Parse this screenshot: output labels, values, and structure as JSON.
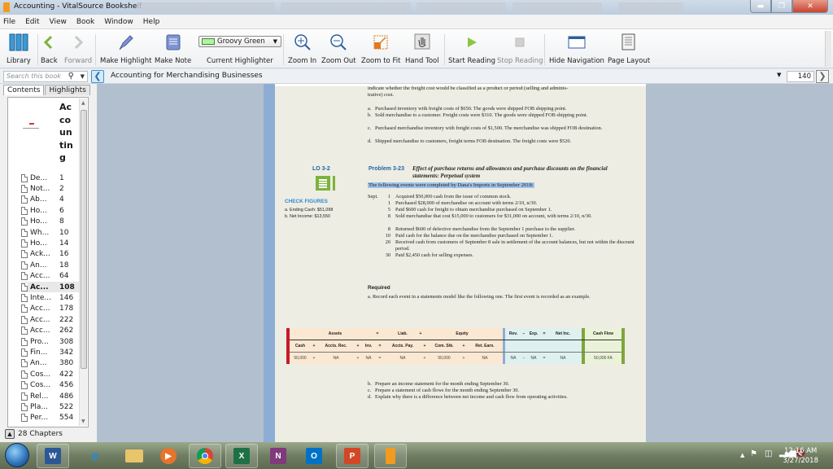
{
  "window": {
    "title": "Accounting - VitalSource Bookshelf",
    "controls": [
      "minimize",
      "restore",
      "close"
    ]
  },
  "menu": [
    "File",
    "Edit",
    "View",
    "Book",
    "Window",
    "Help"
  ],
  "toolbar": {
    "library": "Library",
    "back": "Back",
    "forward": "Forward",
    "make_highlight": "Make Highlight",
    "make_note": "Make Note",
    "highlighter_value": "Groovy Green",
    "highlighter_label": "Current Highlighter",
    "zoom_in": "Zoom In",
    "zoom_out": "Zoom Out",
    "zoom_fit": "Zoom to Fit",
    "hand_tool": "Hand Tool",
    "start_reading": "Start Reading",
    "stop_reading": "Stop Reading",
    "hide_nav": "Hide Navigation",
    "page_layout": "Page Layout",
    "highlight_color": "#b6f0a8"
  },
  "nav": {
    "search_placeholder": "Search this book",
    "breadcrumb": "Accounting for Merchandising Businesses",
    "page": "140"
  },
  "sidebar": {
    "tabs": [
      "Contents",
      "Highlights"
    ],
    "cover_title": "Ac co un tin g",
    "toc": [
      {
        "t": "De...",
        "p": "1"
      },
      {
        "t": "Not...",
        "p": "2"
      },
      {
        "t": "Ab...",
        "p": "4"
      },
      {
        "t": "Ho...",
        "p": "6"
      },
      {
        "t": "Ho...",
        "p": "8"
      },
      {
        "t": "Wh...",
        "p": "10"
      },
      {
        "t": "Ho...",
        "p": "14"
      },
      {
        "t": "Ack...",
        "p": "16"
      },
      {
        "t": "An...",
        "p": "18"
      },
      {
        "t": "Acc...",
        "p": "64"
      },
      {
        "t": "Ac...",
        "p": "108",
        "selected": true
      },
      {
        "t": "Inte...",
        "p": "146"
      },
      {
        "t": "Acc...",
        "p": "178"
      },
      {
        "t": "Acc...",
        "p": "222"
      },
      {
        "t": "Acc...",
        "p": "262"
      },
      {
        "t": "Pro...",
        "p": "308"
      },
      {
        "t": "Fin...",
        "p": "342"
      },
      {
        "t": "An...",
        "p": "380"
      },
      {
        "t": "Cos...",
        "p": "422"
      },
      {
        "t": "Cos...",
        "p": "456"
      },
      {
        "t": "Rel...",
        "p": "486"
      },
      {
        "t": "Pla...",
        "p": "522"
      },
      {
        "t": "Per...",
        "p": "554"
      }
    ],
    "chapters": "28 Chapters"
  },
  "page": {
    "intro1": "indicate whether the freight cost would be classified as a product or period (selling and adminis-",
    "intro2": "trative) cost.",
    "items": [
      {
        "l": "a.",
        "t": "Purchased inventory with freight costs of $650. The goods were shipped FOB shipping point."
      },
      {
        "l": "b.",
        "t": "Sold merchandise to a customer. Freight costs were $310. The goods were shipped FOB shipping point."
      },
      {
        "l": "c.",
        "t": "Purchased merchandise inventory with freight costs of $1,500. The merchandise was shipped FOB destination."
      },
      {
        "l": "d.",
        "t": "Shipped merchandise to customers, freight terms FOB destination. The freight costs were $520."
      }
    ],
    "lo": "LO 3-2",
    "check_title": "CHECK FIGURES",
    "check_a": "a. Ending Cash: $51,098",
    "check_b": "b. Net Income: $13,550",
    "problem_number": "Problem 3-23",
    "problem_title": "Effect of purchase returns and allowances and purchase discounts on the financial statements: Perpetual system",
    "highlighted_text": "The following events were completed by Dana's Imports in September 2018:",
    "month": "Sept.",
    "events": [
      {
        "d": "1",
        "t": "Acquired $50,000 cash from the issue of common stock."
      },
      {
        "d": "1",
        "t": "Purchased $28,000 of merchandise on account with terms 2/10, n/30."
      },
      {
        "d": "5",
        "t": "Paid $600 cash for freight to obtain merchandise purchased on September 1."
      },
      {
        "d": "8",
        "t": "Sold merchandise that cost $15,000 to customers for $31,000 on account, with terms 2/10, n/30."
      },
      {
        "d": "8",
        "t": "Returned $600 of defective merchandise from the September 1 purchase to the supplier."
      },
      {
        "d": "10",
        "t": "Paid cash for the balance due on the merchandise purchased on September 1."
      },
      {
        "d": "20",
        "t": "Received cash from customers of September 8 sale in settlement of the account balances, but not within the discount period."
      },
      {
        "d": "30",
        "t": "Paid $2,450 cash for selling expenses."
      }
    ],
    "required": "Required",
    "req_a": "a.  Record each event in a statements model like the following one. The first event is recorded as an example.",
    "model": {
      "h1": {
        "assets": "Assets",
        "eq1": "=",
        "liab": "Liab.",
        "plus": "+",
        "equity": "Equity",
        "rev": "Rev.",
        "minus": "−",
        "exp": "Exp.",
        "eq2": "=",
        "netinc": "Net Inc.",
        "cf": "Cash Flow"
      },
      "h2": [
        "Cash",
        "+",
        "Accts. Rec.",
        "+",
        "Inv.",
        "=",
        "Accts. Pay.",
        "+",
        "Com. Stk.",
        "+",
        "Ret. Earn."
      ],
      "r1": [
        "50,000",
        "+",
        "NA",
        "+",
        "NA",
        "=",
        "NA",
        "+",
        "50,000",
        "+",
        "NA"
      ],
      "r1b": [
        "NA",
        "−",
        "NA",
        "=",
        "NA"
      ],
      "r1c": "50,000  FA"
    },
    "req_rest": [
      {
        "l": "b.",
        "t": "Prepare an income statement for the month ending September 30."
      },
      {
        "l": "c.",
        "t": "Prepare a statement of cash flows for the month ending September 30."
      },
      {
        "l": "d.",
        "t": "Explain why there is a difference between net income and cash flow from operating activities."
      }
    ]
  },
  "taskbar": {
    "apps": [
      "Word",
      "Internet Explorer",
      "File Explorer",
      "Media Player",
      "Chrome",
      "Excel",
      "OneNote",
      "Outlook",
      "PowerPoint",
      "VitalSource"
    ],
    "time": "12:16 AM",
    "date": "3/27/2018"
  }
}
